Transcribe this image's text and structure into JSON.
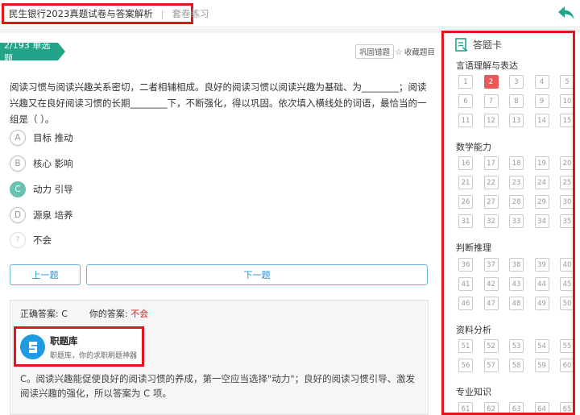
{
  "header": {
    "title": "民生银行2023真题试卷与答案解析",
    "separator": "|",
    "mode": "套卷练习"
  },
  "question": {
    "tag": "2/193 单选题",
    "consolidate_label": "巩固错题",
    "favorite_label": "收藏题目",
    "text": "阅读习惯与阅读兴趣关系密切，二者相辅相成。良好的阅读习惯以阅读兴趣为基础、为________；阅读兴趣又在良好阅读习惯的长期________下，不断强化，得以巩固。依次填入横线处的词语，最恰当的一组是（ ）。",
    "options": [
      {
        "letter": "A",
        "text": "目标 推动",
        "selected": false
      },
      {
        "letter": "B",
        "text": "核心 影响",
        "selected": false
      },
      {
        "letter": "C",
        "text": "动力 引导",
        "selected": true
      },
      {
        "letter": "D",
        "text": "源泉 培养",
        "selected": false
      },
      {
        "letter": "?",
        "text": "不会",
        "selected": false
      }
    ]
  },
  "nav": {
    "prev": "上一题",
    "next": "下一题"
  },
  "answer": {
    "correct_label": "正确答案:",
    "correct_value": "C",
    "your_label": "你的答案:",
    "your_value": "不会",
    "brand_name": "职题库",
    "brand_sub": "职题库，你的求职刷题神器",
    "analysis": "C。阅读兴趣能促使良好的阅读习惯的养成，第一空应当选择\"动力\"；良好的阅读习惯引导、激发阅读兴趣的强化，所以答案为 C 项。"
  },
  "answer_card": {
    "title": "答题卡",
    "sections": [
      {
        "name": "言语理解与表达",
        "items": [
          "1",
          "2",
          "3",
          "4",
          "5",
          "6",
          "7",
          "8",
          "9",
          "10",
          "11",
          "12",
          "13",
          "14",
          "15"
        ]
      },
      {
        "name": "数学能力",
        "items": [
          "16",
          "17",
          "18",
          "19",
          "20",
          "21",
          "22",
          "23",
          "24",
          "25",
          "26",
          "27",
          "28",
          "29",
          "30",
          "31",
          "32",
          "33",
          "34",
          "35"
        ]
      },
      {
        "name": "判断推理",
        "items": [
          "36",
          "37",
          "38",
          "39",
          "40",
          "41",
          "42",
          "43",
          "44",
          "45",
          "46",
          "47",
          "48",
          "49",
          "50"
        ]
      },
      {
        "name": "资料分析",
        "items": [
          "51",
          "52",
          "53",
          "54",
          "55",
          "56",
          "57",
          "58",
          "59",
          "60"
        ]
      },
      {
        "name": "专业知识",
        "items": [
          "61",
          "62",
          "63",
          "64",
          "65"
        ]
      }
    ],
    "active_item": "2"
  },
  "colors": {
    "accent": "#21a48a",
    "highlight": "#e2141c",
    "active_cell": "#e85a5a",
    "link": "#2c8fd0"
  }
}
